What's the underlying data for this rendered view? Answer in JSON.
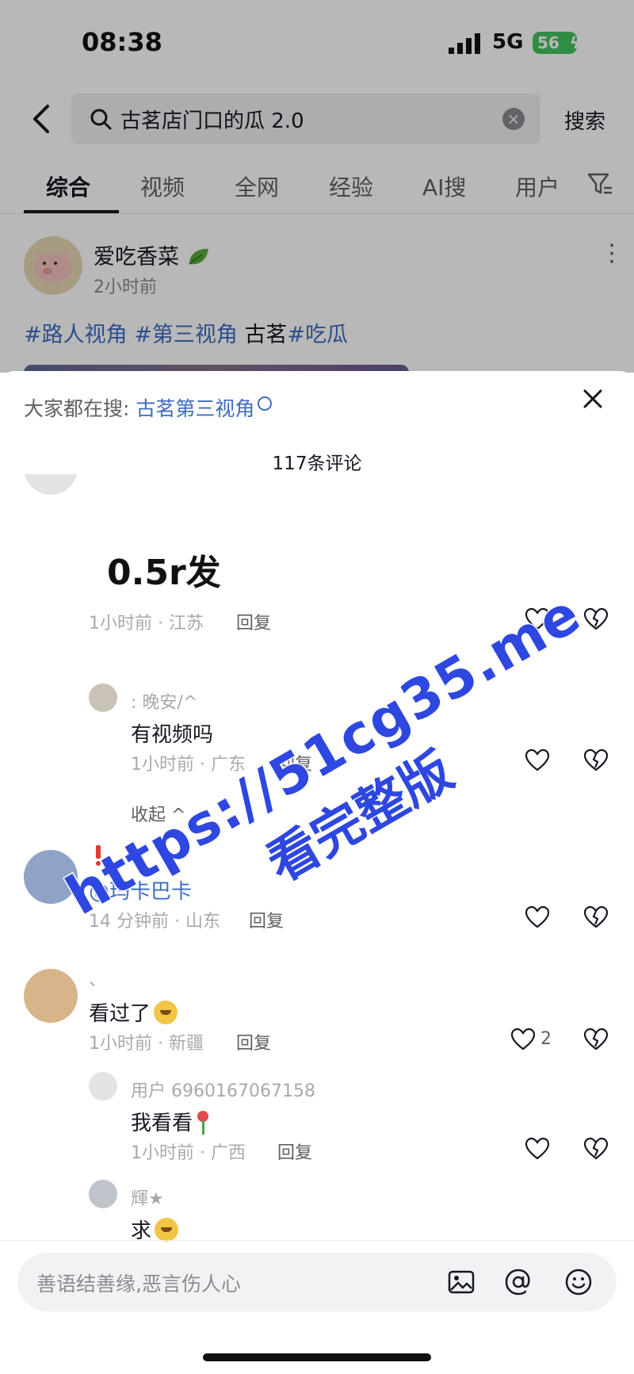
{
  "status_bar": {
    "time": "08:38",
    "network": "5G",
    "battery": "56"
  },
  "search": {
    "query": "古茗店门口的瓜 2.0",
    "button_label": "搜索"
  },
  "tabs": [
    "综合",
    "视频",
    "全网",
    "经验",
    "AI搜",
    "用户"
  ],
  "post": {
    "author": "爱吃香菜",
    "time": "2小时前",
    "tags": [
      "#路人视角",
      "#第三视角",
      "古茗",
      "#吃瓜"
    ]
  },
  "sheet": {
    "trending_label": "大家都在搜:",
    "trending_keyword": "古茗第三视角",
    "comment_count": "117条评论"
  },
  "comments": [
    {
      "text": "0.5r发",
      "meta": "1小时前 · 江苏",
      "reply_label": "回复",
      "replies": [
        {
          "user": ": 晚安/^",
          "text": "有视频吗",
          "meta": "1小时前 · 广东",
          "reply_label": "回复"
        }
      ],
      "collapse_label": "收起"
    },
    {
      "mention": "@玛卡巴卡",
      "meta": "14 分钟前 · 山东",
      "reply_label": "回复"
    },
    {
      "user": "、",
      "text": "看过了",
      "meta": "1小时前 · 新疆",
      "reply_label": "回复",
      "likes": "2",
      "replies": [
        {
          "user": "用户 6960167067158",
          "text": "我看看",
          "meta": "1小时前 · 广西",
          "reply_label": "回复"
        },
        {
          "user": "輝★",
          "text": "求"
        }
      ]
    }
  ],
  "watermark": {
    "line1": "https://51cg35.me",
    "line2": "看完整版"
  },
  "input": {
    "placeholder": "善语结善缘,恶言伤人心"
  },
  "colors": {
    "link": "#3d6cc2",
    "battery": "#45c35f",
    "watermark": "#2e47e0"
  }
}
